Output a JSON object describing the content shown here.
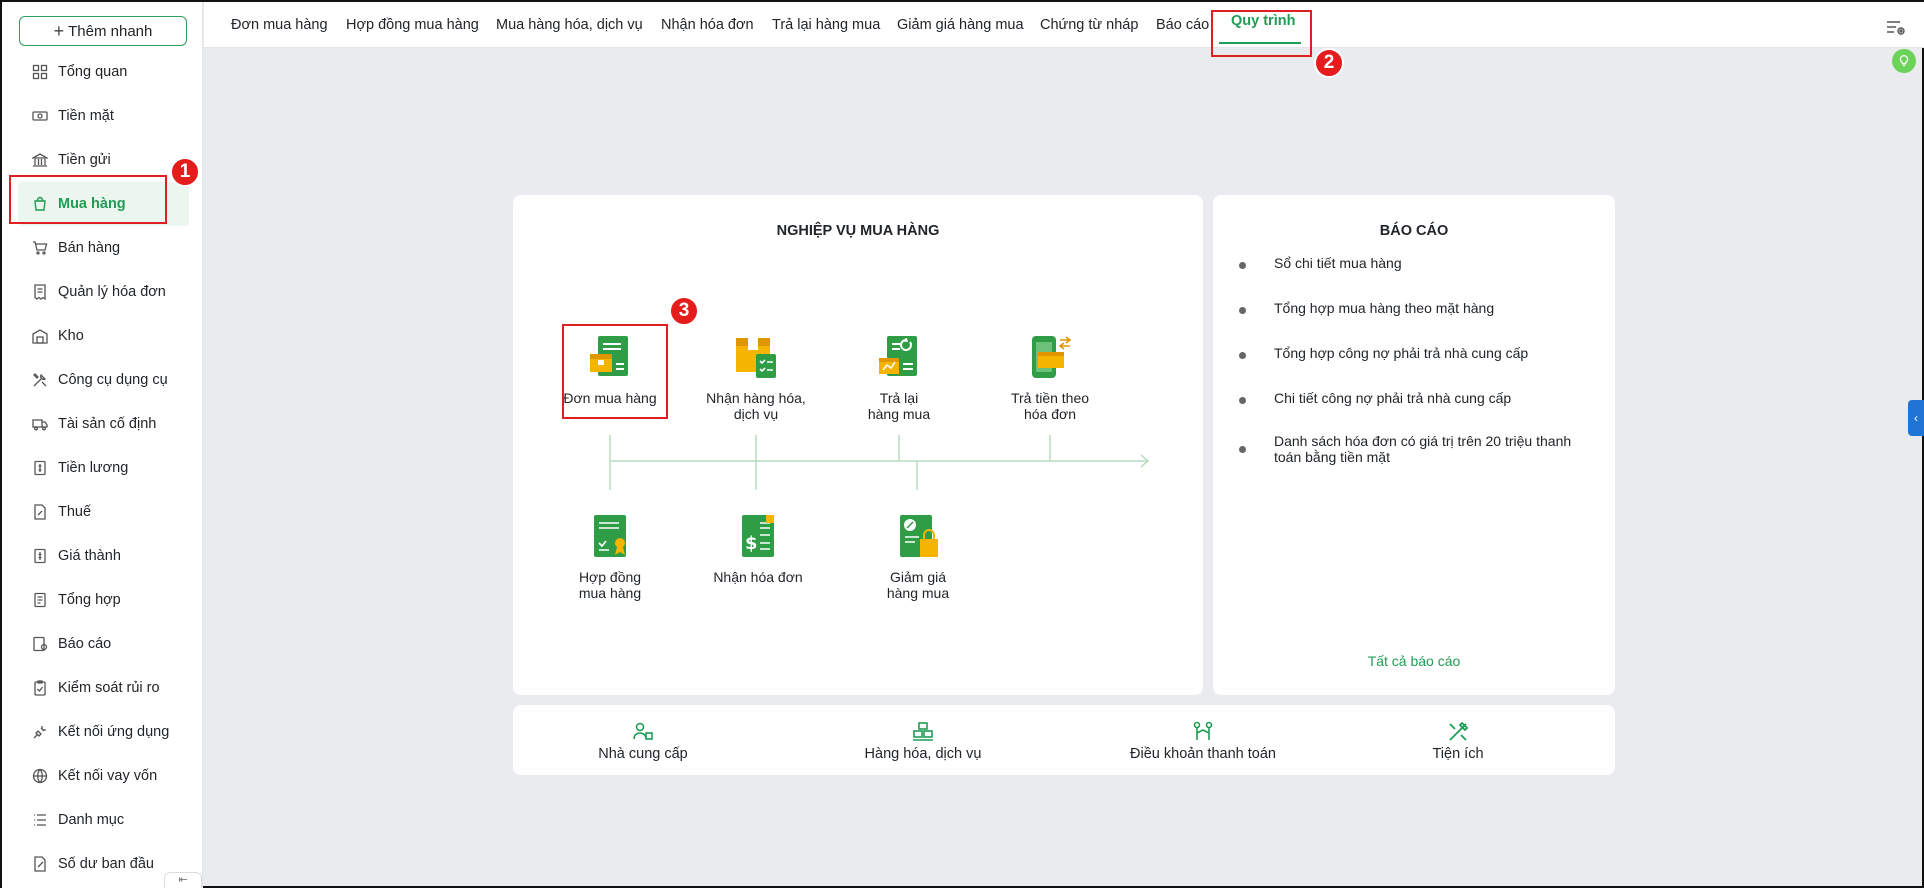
{
  "sidebar": {
    "add_button": "Thêm nhanh",
    "items": [
      {
        "label": "Tổng quan"
      },
      {
        "label": "Tiền mặt"
      },
      {
        "label": "Tiền gửi"
      },
      {
        "label": "Mua hàng"
      },
      {
        "label": "Bán hàng"
      },
      {
        "label": "Quản lý hóa đơn"
      },
      {
        "label": "Kho"
      },
      {
        "label": "Công cụ dụng cụ"
      },
      {
        "label": "Tài sản cố định"
      },
      {
        "label": "Tiền lương"
      },
      {
        "label": "Thuế"
      },
      {
        "label": "Giá thành"
      },
      {
        "label": "Tổng hợp"
      },
      {
        "label": "Báo cáo"
      },
      {
        "label": "Kiểm soát rủi ro"
      },
      {
        "label": "Kết nối ứng dụng"
      },
      {
        "label": "Kết nối vay vốn"
      },
      {
        "label": "Danh mục"
      },
      {
        "label": "Số dư ban đầu"
      }
    ],
    "active_index": 3
  },
  "tabs": [
    "Đơn mua hàng",
    "Hợp đồng mua hàng",
    "Mua hàng hóa, dịch vụ",
    "Nhận hóa đơn",
    "Trả lại hàng mua",
    "Giảm giá hàng mua",
    "Chứng từ nháp",
    "Báo cáo",
    "Quy trình"
  ],
  "active_tab": "Quy trình",
  "workflow": {
    "title": "NGHIỆP VỤ MUA HÀNG",
    "top": [
      {
        "line1": "Đơn mua hàng",
        "line2": ""
      },
      {
        "line1": "Nhận hàng hóa,",
        "line2": "dịch vụ"
      },
      {
        "line1": "Trả lại",
        "line2": "hàng mua"
      },
      {
        "line1": "Trả tiền theo",
        "line2": "hóa đơn"
      }
    ],
    "bottom": [
      {
        "line1": "Hợp đồng",
        "line2": "mua hàng"
      },
      {
        "line1": "Nhận hóa đơn",
        "line2": ""
      },
      {
        "line1": "Giảm giá",
        "line2": "hàng mua"
      }
    ]
  },
  "reports": {
    "title": "BÁO CÁO",
    "items": [
      "Sổ chi tiết mua hàng",
      "Tổng hợp mua hàng theo mặt hàng",
      "Tổng hợp công nợ phải trả nhà cung cấp",
      "Chi tiết công nợ phải trả nhà cung cấp",
      "Danh sách hóa đơn có giá trị trên 20 triệu thanh toán bằng tiền mặt"
    ],
    "all_link": "Tất cả báo cáo"
  },
  "utilities": [
    {
      "label": "Nhà cung cấp",
      "icon": "supplier-icon"
    },
    {
      "label": "Hàng hóa, dịch vụ",
      "icon": "goods-icon"
    },
    {
      "label": "Điều khoản thanh toán",
      "icon": "payment-terms-icon"
    },
    {
      "label": "Tiện ích",
      "icon": "tools-icon"
    }
  ],
  "callouts": [
    "1",
    "2",
    "3"
  ],
  "colors": {
    "accent": "#1f9d55",
    "callout": "#e41c1c",
    "doc_green": "#2e9d45",
    "doc_yellow": "#f4b400"
  }
}
